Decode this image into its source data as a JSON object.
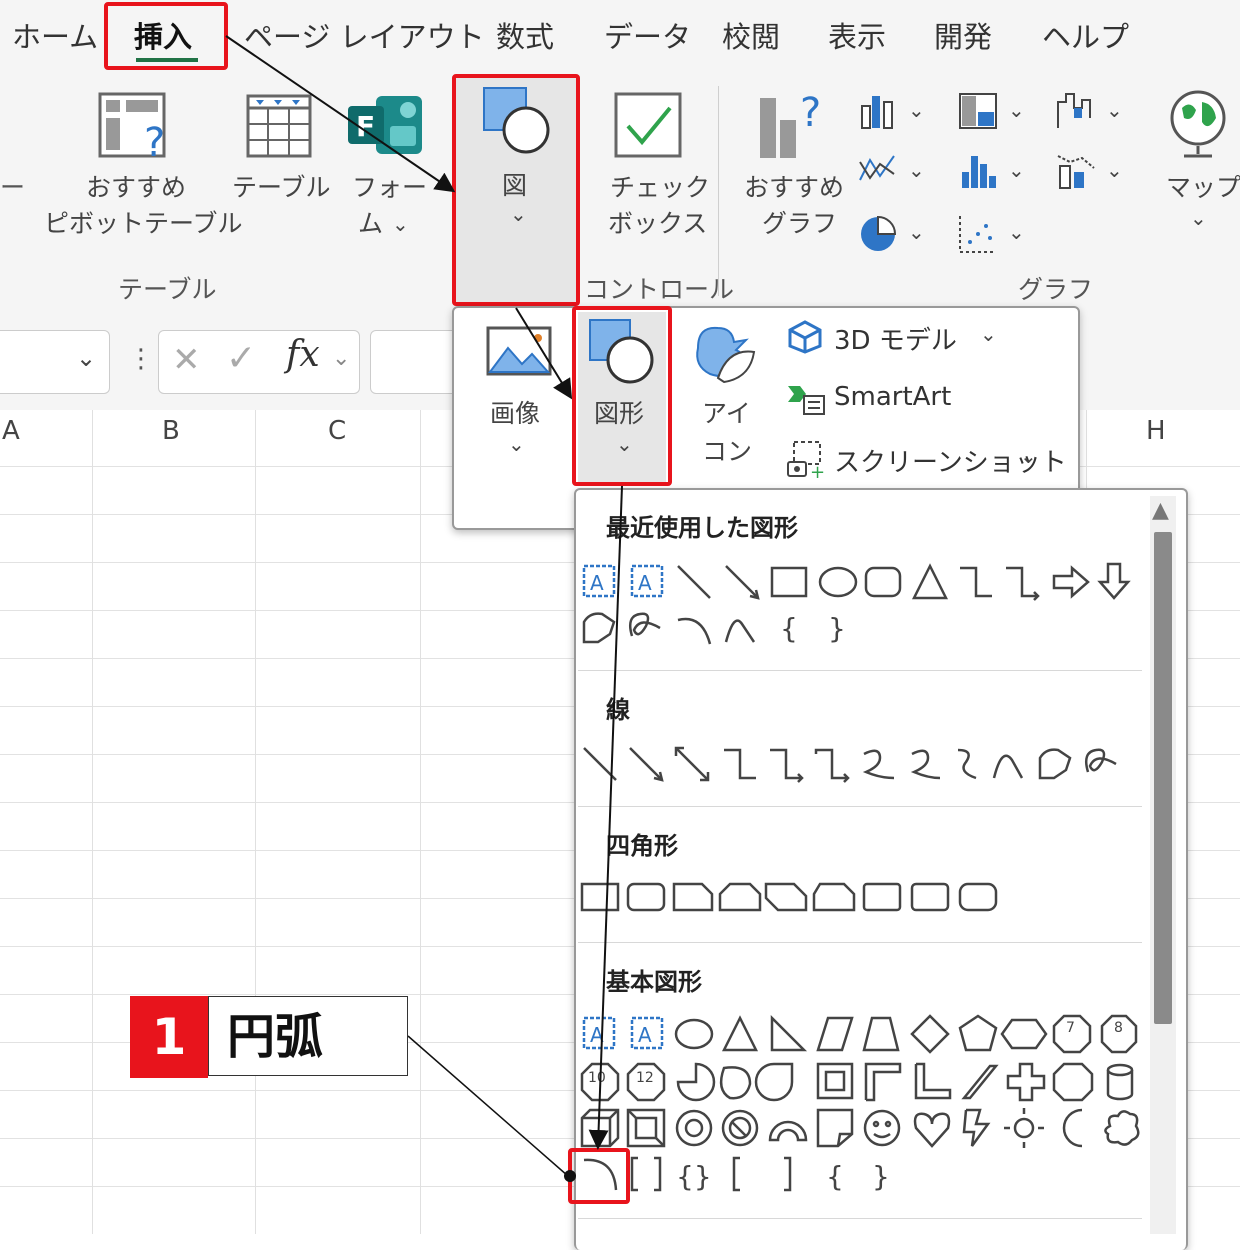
{
  "tabs": [
    "ホーム",
    "挿入",
    "ページ レイアウト",
    "数式",
    "データ",
    "校閲",
    "表示",
    "開発",
    "ヘルプ"
  ],
  "ribbon": {
    "cut_label": "ー",
    "pivot_label_1": "おすすめ",
    "pivot_label_2": "ピボットテーブル",
    "table_label": "テーブル",
    "forms_label_1": "フォー",
    "forms_label_2": "ム",
    "shapes_label": "図",
    "checkbox_label_1": "チェック",
    "checkbox_label_2": "ボックス",
    "recchart_label_1": "おすすめ",
    "recchart_label_2": "グラフ",
    "map_label": "マップ",
    "group_table": "テーブル",
    "group_control": "コントロール",
    "group_chart": "グラフ"
  },
  "formula": {
    "fx": "fx"
  },
  "columns": [
    "A",
    "B",
    "C",
    "H"
  ],
  "popup": {
    "image_label": "画像",
    "shapes_label": "図形",
    "icons_label_1": "アイ",
    "icons_label_2": "コン",
    "model3d_label": "3D モデル",
    "smartart_label": "SmartArt",
    "screenshot_label": "スクリーンショット"
  },
  "gallery": {
    "recent": "最近使用した図形",
    "lines": "線",
    "rects": "四角形",
    "basic": "基本図形"
  },
  "callout": {
    "number": "1",
    "text": "円弧"
  },
  "colors": {
    "accent_red": "#e8141c",
    "excel_green": "#217346",
    "blue": "#2e75c6"
  }
}
